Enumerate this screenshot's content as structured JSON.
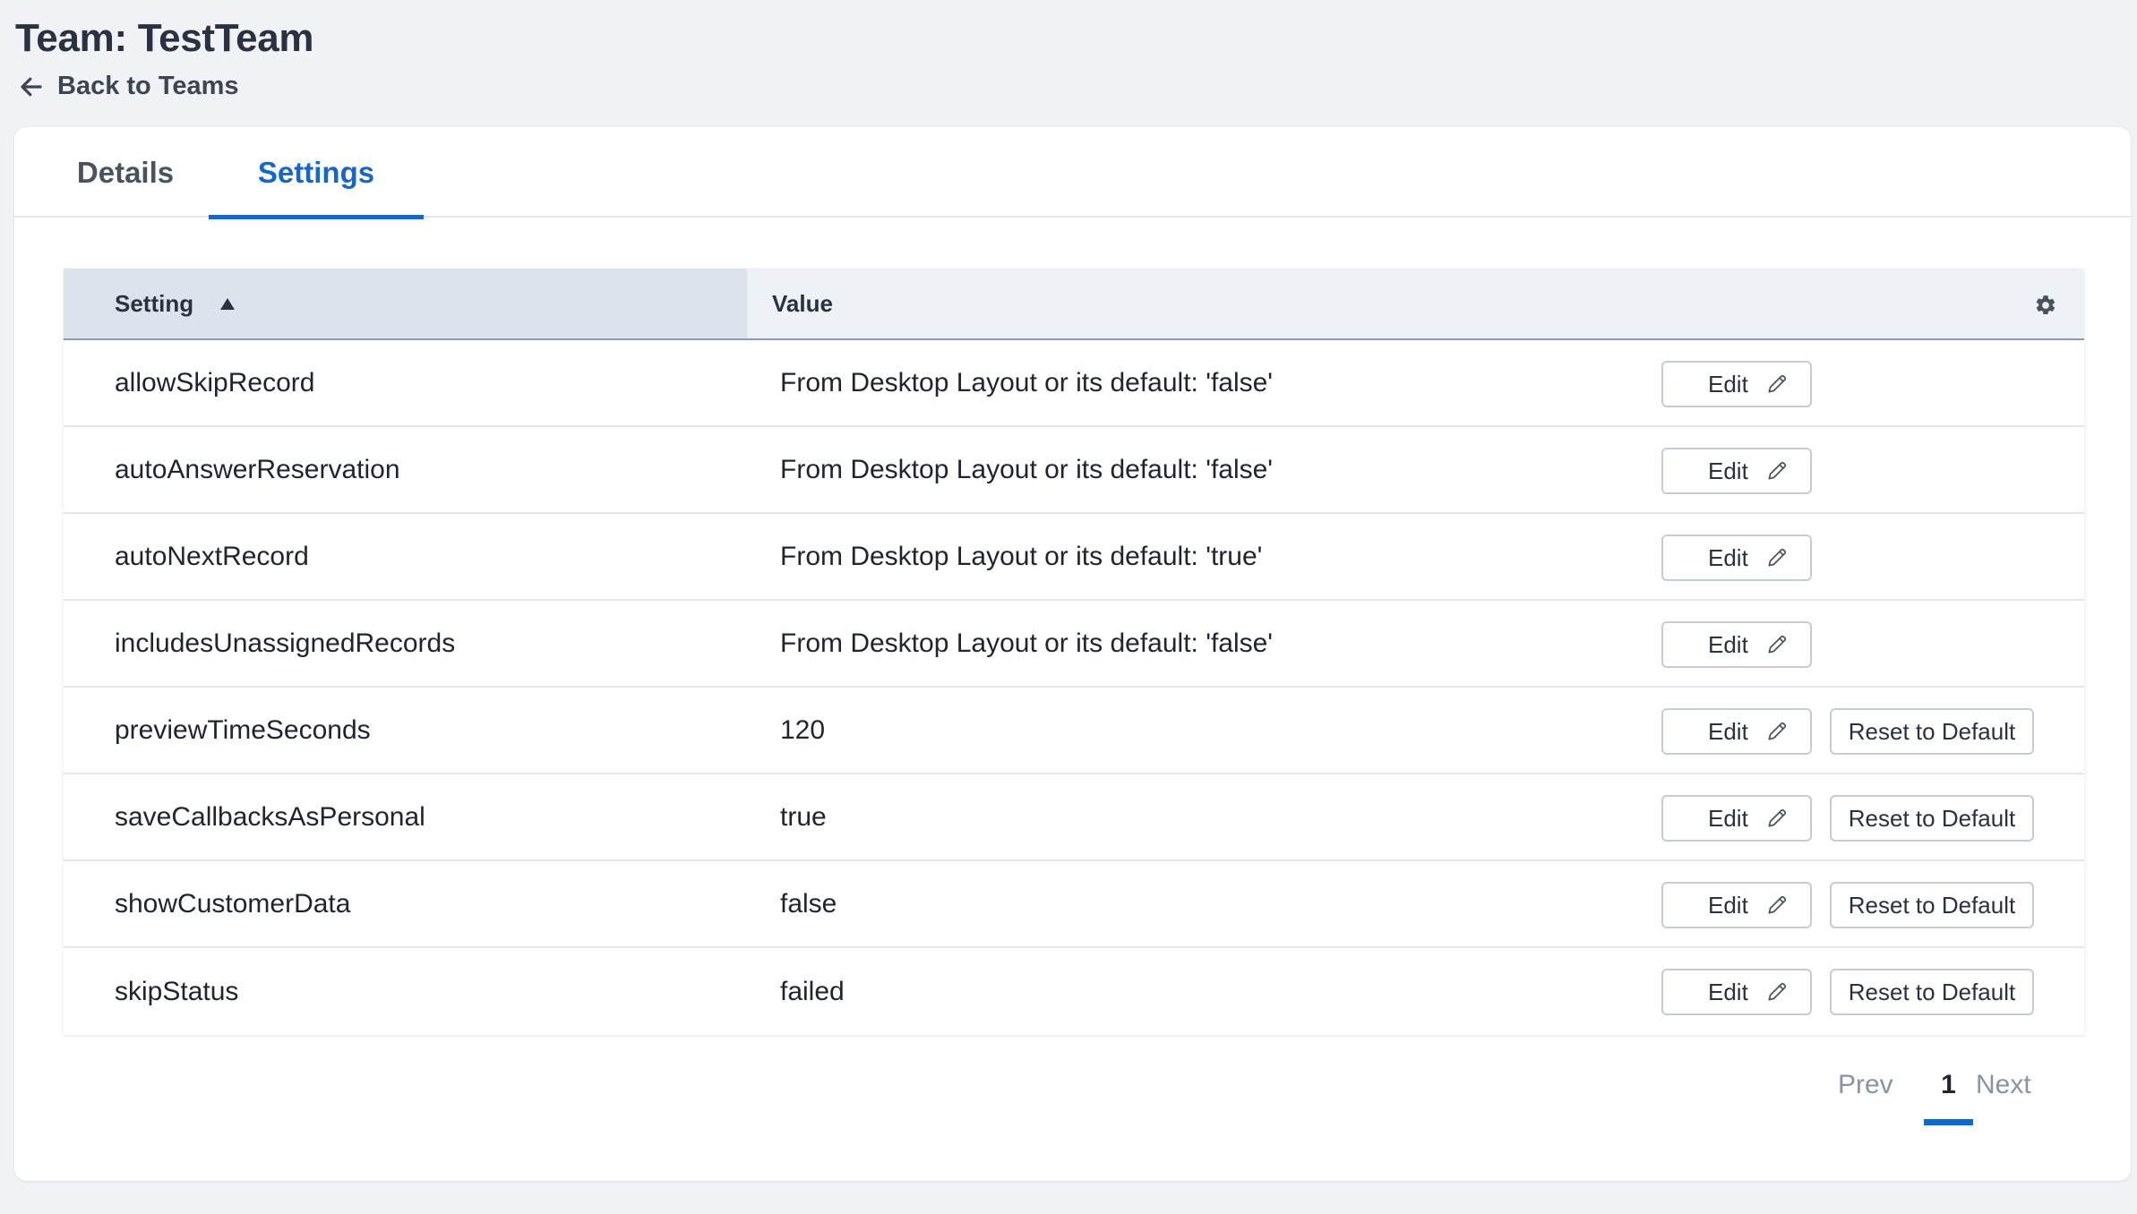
{
  "page": {
    "title": "Team: TestTeam",
    "back_label": "Back to Teams"
  },
  "tabs": [
    {
      "label": "Details",
      "active": false
    },
    {
      "label": "Settings",
      "active": true
    }
  ],
  "table": {
    "columns": {
      "setting": "Setting",
      "value": "Value"
    },
    "sort": {
      "column": "setting",
      "direction": "ascending"
    },
    "rows": [
      {
        "setting": "allowSkipRecord",
        "value": "From Desktop Layout or its default: 'false'",
        "edit": "Edit",
        "reset": ""
      },
      {
        "setting": "autoAnswerReservation",
        "value": "From Desktop Layout or its default: 'false'",
        "edit": "Edit",
        "reset": ""
      },
      {
        "setting": "autoNextRecord",
        "value": "From Desktop Layout or its default: 'true'",
        "edit": "Edit",
        "reset": ""
      },
      {
        "setting": "includesUnassignedRecords",
        "value": "From Desktop Layout or its default: 'false'",
        "edit": "Edit",
        "reset": ""
      },
      {
        "setting": "previewTimeSeconds",
        "value": "120",
        "edit": "Edit",
        "reset": "Reset to Default"
      },
      {
        "setting": "saveCallbacksAsPersonal",
        "value": "true",
        "edit": "Edit",
        "reset": "Reset to Default"
      },
      {
        "setting": "showCustomerData",
        "value": "false",
        "edit": "Edit",
        "reset": "Reset to Default"
      },
      {
        "setting": "skipStatus",
        "value": "failed",
        "edit": "Edit",
        "reset": "Reset to Default"
      }
    ]
  },
  "pagination": {
    "prev": "Prev",
    "current": "1",
    "next": "Next"
  },
  "icons": {
    "back": "arrow-left-icon",
    "sort": "sort-ascending-icon",
    "settings": "gear-icon",
    "edit": "pencil-icon"
  },
  "colors": {
    "accent": "#1767c4",
    "background": "#f0f2f5",
    "header_sorted": "#dde3ec",
    "header": "#eef1f5"
  }
}
